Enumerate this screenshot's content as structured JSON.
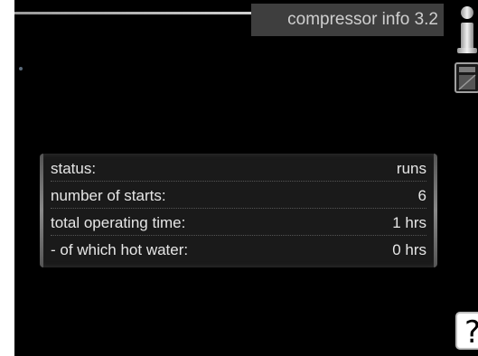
{
  "header": {
    "title": "compressor info 3.2"
  },
  "icons": {
    "info": "info-icon",
    "panel": "panel-icon",
    "help": "help-icon"
  },
  "help": {
    "label": "?"
  },
  "info_rows": [
    {
      "label": "status:",
      "value": "runs"
    },
    {
      "label": "number of starts:",
      "value": "6"
    },
    {
      "label": "total operating time:",
      "value": "1 hrs"
    },
    {
      "label": "- of which hot water:",
      "value": "0 hrs"
    }
  ],
  "colors": {
    "background": "#000000",
    "title_bg": "#3e3e3e",
    "text": "#e6e6e6"
  }
}
